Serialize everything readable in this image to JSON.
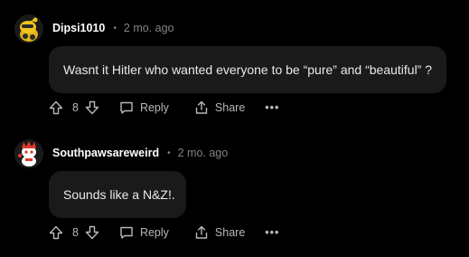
{
  "comments": [
    {
      "username": "Dipsi1010",
      "separator": "•",
      "time": "2 mo. ago",
      "text": "Wasnt it Hitler who wanted everyone to be “pure” and “beautiful” ?",
      "votes": "8",
      "reply_label": "Reply",
      "share_label": "Share",
      "more_label": "•••",
      "avatar_icon": "snoo-avatar-yellow-icon"
    },
    {
      "username": "Southpawsareweird",
      "separator": "•",
      "time": "2 mo. ago",
      "text": "Sounds like a N&Z!.",
      "votes": "8",
      "reply_label": "Reply",
      "share_label": "Share",
      "more_label": "•••",
      "avatar_icon": "snoo-avatar-red-icon"
    }
  ],
  "colors": {
    "background": "#000000",
    "bubble": "#1a1a1b",
    "meta_text": "#818384",
    "action_text": "#b5b8ba"
  }
}
